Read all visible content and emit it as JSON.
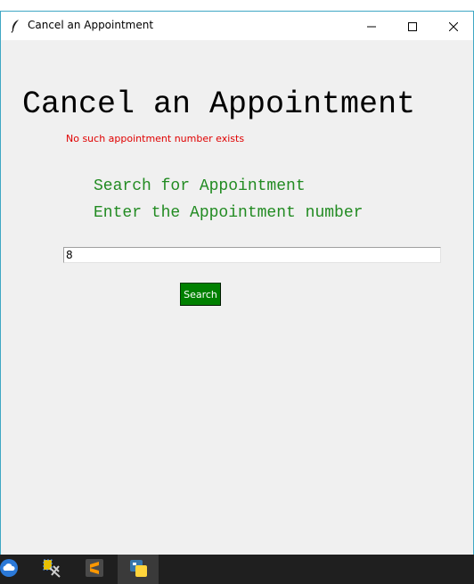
{
  "window": {
    "title": "Cancel an Appointment",
    "icon": "feather-icon"
  },
  "controls": {
    "minimize_icon": "minimize-icon",
    "maximize_icon": "maximize-icon",
    "close_icon": "close-icon"
  },
  "main": {
    "heading": "Cancel an Appointment",
    "error_message": "No such appointment number exists",
    "search_title": "Search for Appointment",
    "prompt": "Enter the Appointment number",
    "appointment_input": {
      "value": "8",
      "placeholder": ""
    },
    "search_label": "Search"
  },
  "taskbar": {
    "items": [
      {
        "icon": "cloud-icon"
      },
      {
        "icon": "build-tools-icon"
      },
      {
        "icon": "sublime-text-icon"
      },
      {
        "icon": "python-icon",
        "active": true
      }
    ]
  },
  "colors": {
    "heading": "#000000",
    "error": "#e00000",
    "subheading": "#228b22",
    "button_bg": "#008000",
    "button_text": "#ffffff",
    "window_bg": "#f0f0f0",
    "window_border": "#3fa7c4",
    "taskbar_bg": "#1f1f1f"
  }
}
